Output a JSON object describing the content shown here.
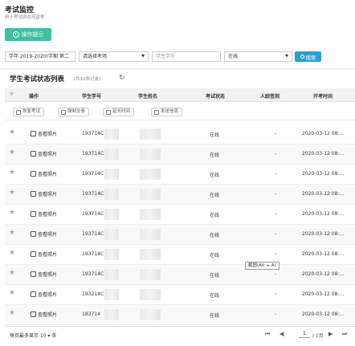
{
  "page": {
    "title": "考试监控",
    "subtitle": "用于考试的在线监考"
  },
  "tip_button": {
    "label": "操作提示"
  },
  "filters": {
    "term": "学年 2019-2020(学期 第二",
    "exam_placeholder": "请选择考场",
    "student_id_placeholder": "学生学号",
    "status": "在线",
    "search_label": "搜索"
  },
  "list": {
    "title": "学生考试状态列表",
    "count": "(共10条记录)"
  },
  "table": {
    "headers": [
      "操作",
      "学生学号",
      "学生姓名",
      "考试状态",
      "人脸签到",
      "开考时间"
    ],
    "actions": [
      "恢复考试",
      "强制交卷",
      "延长时间",
      "发送信息"
    ],
    "rows": [
      {
        "view": "查看照片",
        "id": "193714C",
        "status": "在线",
        "face": "-",
        "time": "2020-03-12 08:..."
      },
      {
        "view": "查看照片",
        "id": "193714C",
        "status": "在线",
        "face": "-",
        "time": "2020-03-12 08:..."
      },
      {
        "view": "查看照片",
        "id": "193714C",
        "status": "在线",
        "face": "-",
        "time": "2020-03-12 08:..."
      },
      {
        "view": "查看照片",
        "id": "193714C",
        "status": "在线",
        "face": "-",
        "time": "2020-03-12 08:..."
      },
      {
        "view": "查看照片",
        "id": "193714C",
        "status": "在线",
        "face": "-",
        "time": "2020-03-12 08:..."
      },
      {
        "view": "查看照片",
        "id": "193714C",
        "status": "在线",
        "face": "-",
        "time": "2020-03-12 08:..."
      },
      {
        "view": "查看照片",
        "id": "193714C",
        "status": "在线",
        "face": "-",
        "time": "2020-03-12 08:..."
      },
      {
        "view": "查看照片",
        "id": "193714C",
        "status": "在线",
        "face": "-",
        "time": "2020-03-12 08:..."
      },
      {
        "view": "查看照片",
        "id": "193214C",
        "status": "在线",
        "face": "-",
        "time": "2020-03-12 08:..."
      },
      {
        "view": "查看照片",
        "id": "183714",
        "status": "在线",
        "face": "-",
        "time": "2020-03-12 08:..."
      }
    ]
  },
  "tooltip": "截图(Alt + A)",
  "footer": {
    "per_page": "每页最多显示 10 ▾ 条",
    "page_current": "1",
    "page_total": "/ 1页"
  }
}
